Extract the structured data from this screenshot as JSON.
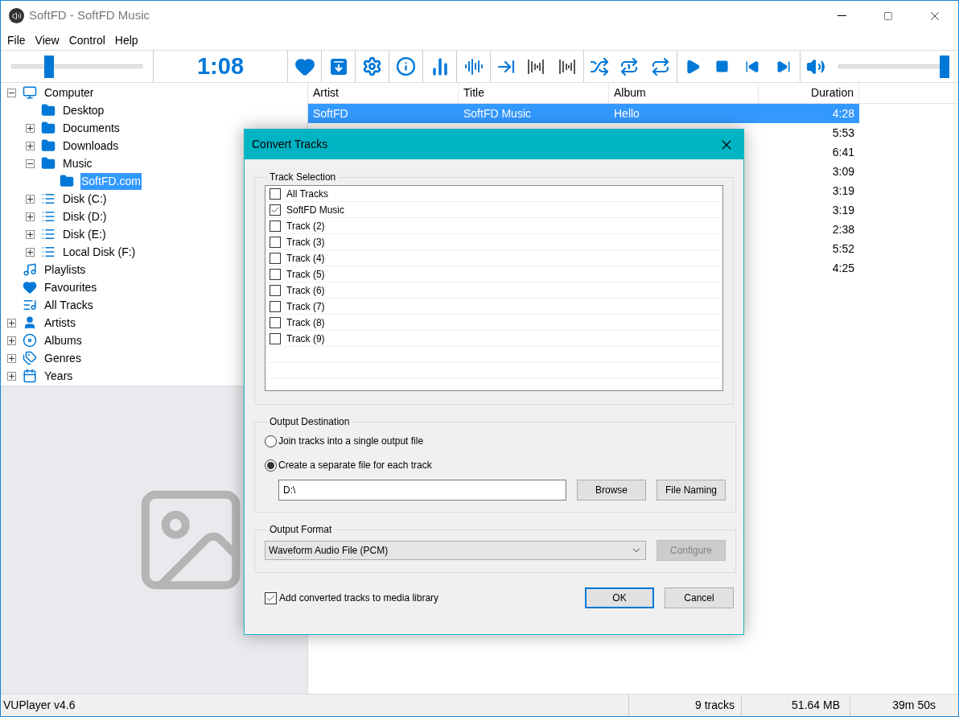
{
  "window": {
    "title": "SoftFD - SoftFD Music"
  },
  "menu": [
    "File",
    "View",
    "Control",
    "Help"
  ],
  "toolbar": {
    "seek": {
      "level": 0.27
    },
    "time": "1:08",
    "volume": {
      "level": 1
    }
  },
  "tree": [
    {
      "label": "Computer",
      "kind": "computer",
      "expanded": true,
      "selected": false,
      "children": [
        {
          "label": "Desktop",
          "kind": "folder",
          "selected": false
        },
        {
          "label": "Documents",
          "kind": "folder",
          "expanded": false,
          "selected": false
        },
        {
          "label": "Downloads",
          "kind": "folder",
          "expanded": false,
          "selected": false
        },
        {
          "label": "Music",
          "kind": "folder",
          "expanded": true,
          "selected": false,
          "children": [
            {
              "label": "SoftFD.com",
              "kind": "folder",
              "selected": true
            }
          ]
        },
        {
          "label": "Disk (C:)",
          "kind": "disk",
          "expanded": false,
          "selected": false
        },
        {
          "label": "Disk (D:)",
          "kind": "disk",
          "expanded": false,
          "selected": false
        },
        {
          "label": "Disk (E:)",
          "kind": "disk",
          "expanded": false,
          "selected": false
        },
        {
          "label": "Local Disk (F:)",
          "kind": "disk",
          "expanded": false,
          "selected": false
        }
      ]
    },
    {
      "label": "Playlists",
      "kind": "playlists",
      "selected": false
    },
    {
      "label": "Favourites",
      "kind": "favourites",
      "selected": false
    },
    {
      "label": "All Tracks",
      "kind": "tracks",
      "selected": false
    },
    {
      "label": "Artists",
      "kind": "artists",
      "expanded": false,
      "selected": false
    },
    {
      "label": "Albums",
      "kind": "albums",
      "expanded": false,
      "selected": false
    },
    {
      "label": "Genres",
      "kind": "genres",
      "expanded": false,
      "selected": false
    },
    {
      "label": "Years",
      "kind": "years",
      "expanded": false,
      "selected": false
    }
  ],
  "table": {
    "columns": [
      "Artist",
      "Title",
      "Album",
      "Duration"
    ],
    "rows": [
      {
        "artist": "SoftFD",
        "title": "SoftFD Music",
        "album": "Hello",
        "duration": "4:28",
        "selected": true
      },
      {
        "duration": "5:53",
        "selected": false
      },
      {
        "duration": "6:41",
        "selected": false
      },
      {
        "duration": "3:09",
        "selected": false
      },
      {
        "duration": "3:19",
        "selected": false
      },
      {
        "duration": "3:19",
        "selected": false
      },
      {
        "duration": "2:38",
        "selected": false
      },
      {
        "duration": "5:52",
        "selected": false
      },
      {
        "duration": "4:25",
        "selected": false
      }
    ]
  },
  "dialog": {
    "title": "Convert Tracks",
    "track_selection": {
      "label": "Track Selection",
      "items": [
        {
          "label": "All Tracks",
          "checked": false
        },
        {
          "label": "SoftFD Music",
          "checked": true
        },
        {
          "label": "Track (2)",
          "checked": false
        },
        {
          "label": "Track (3)",
          "checked": false
        },
        {
          "label": "Track (4)",
          "checked": false
        },
        {
          "label": "Track (5)",
          "checked": false
        },
        {
          "label": "Track (6)",
          "checked": false
        },
        {
          "label": "Track (7)",
          "checked": false
        },
        {
          "label": "Track (8)",
          "checked": false
        },
        {
          "label": "Track (9)",
          "checked": false
        }
      ]
    },
    "output_destination": {
      "label": "Output Destination",
      "options": [
        {
          "label": "Join tracks into a single output file",
          "selected": false
        },
        {
          "label": "Create a separate file for each track",
          "selected": true
        }
      ],
      "path": "D:\\",
      "buttons": [
        "Browse",
        "File Naming"
      ]
    },
    "output_format": {
      "label": "Output Format",
      "value": "Waveform Audio File (PCM)",
      "configure": {
        "label": "Configure",
        "disabled": true
      }
    },
    "add_to_library": {
      "label": "Add converted tracks to media library",
      "checked": true
    },
    "buttons": [
      {
        "label": "OK",
        "default": true
      },
      {
        "label": "Cancel",
        "default": false
      }
    ]
  },
  "status_bar": [
    "VUPlayer v4.6",
    "9 tracks",
    "51.64 MB",
    "39m 50s"
  ]
}
